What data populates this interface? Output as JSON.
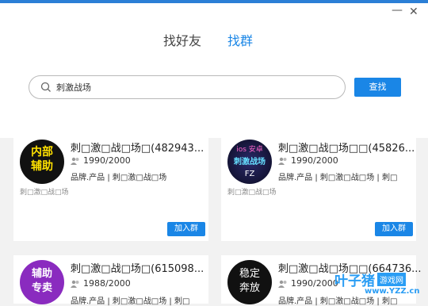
{
  "tabs": {
    "friends": "找好友",
    "groups": "找群"
  },
  "search": {
    "value": "刺激战场",
    "button": "查找"
  },
  "cards": [
    {
      "name": "刺□激□战□场□(482943...",
      "members": "1990/2000",
      "tags": "品牌.产品 | 刺□激□战□场",
      "desc": "刺□激□战□场",
      "join": "加入群",
      "avatar_lines": [
        "内部",
        "辅助"
      ]
    },
    {
      "name": "刺□激□战□场□□(45826...",
      "members": "1990/2000",
      "tags": "品牌.产品 | 刺□激□战□场 | 刺□",
      "desc": "刺□激□战□场",
      "join": "加入群",
      "avatar_lines": [
        "ios 安卓",
        "刺激战场",
        "FZ"
      ]
    },
    {
      "name": "刺□激□战□场□(615098...",
      "members": "1988/2000",
      "tags": "品牌.产品 | 刺□激□战□场 | 刺□",
      "desc": "",
      "join": "",
      "avatar_lines": [
        "辅助",
        "专卖"
      ]
    },
    {
      "name": "刺□激□战□场□□(664736...",
      "members": "1990/2000",
      "tags": "品牌.产品 | 刺□激□战□场 | 刺□",
      "desc": "",
      "join": "",
      "avatar_lines": [
        "稳定",
        "奔放"
      ]
    }
  ],
  "watermark": {
    "brand": "叶子猪",
    "tag": "游戏网",
    "url": "www.YZZ.cn"
  },
  "colors": {
    "accent": "#1a86e6"
  }
}
